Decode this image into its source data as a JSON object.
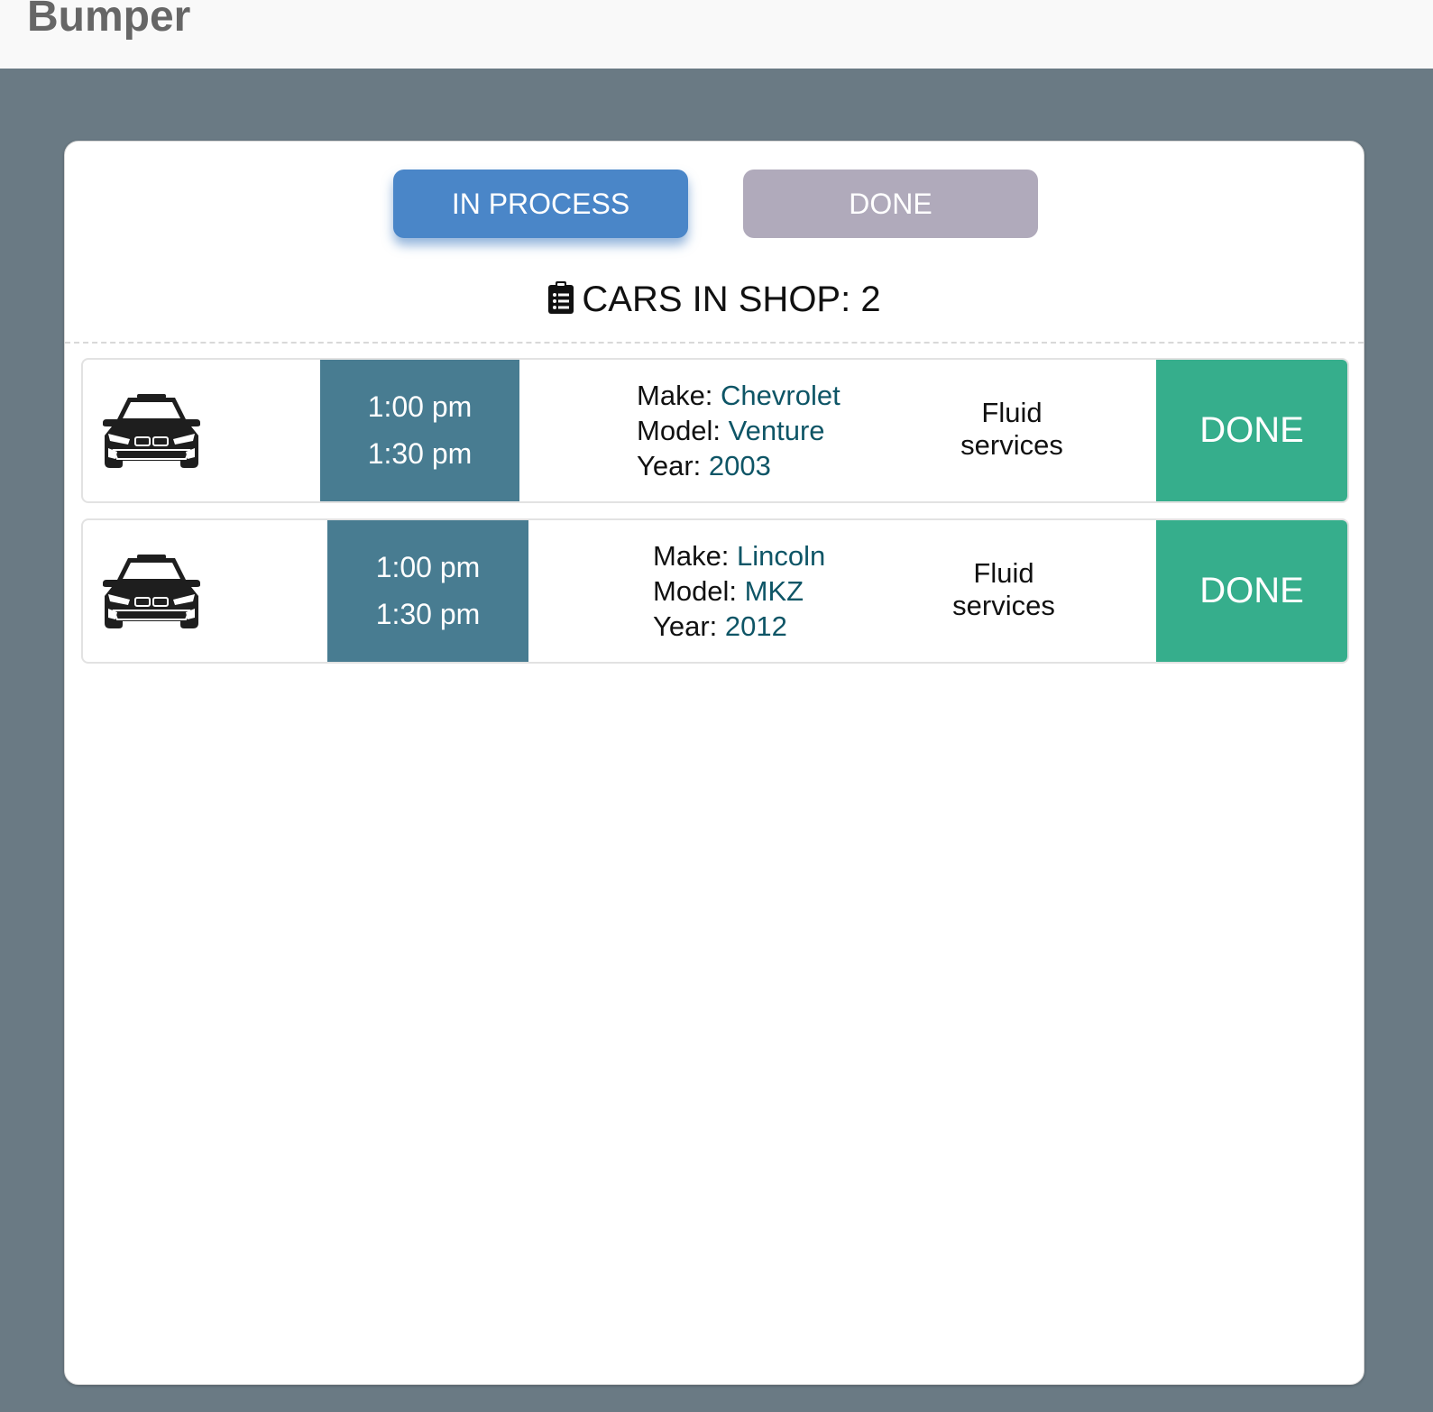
{
  "app": {
    "brand": "Bumper"
  },
  "tabs": [
    {
      "label": "IN PROCESS",
      "active": true
    },
    {
      "label": "DONE",
      "active": false
    }
  ],
  "summary": {
    "label": "CARS IN SHOP: 2",
    "icon": "clipboard-list-icon"
  },
  "colors": {
    "active_tab": "#4a86c8",
    "inactive_tab": "#b0aabb",
    "time_block": "#487c91",
    "done_button": "#36ae8c",
    "value_text": "#0e5566",
    "background": "#6a7a84"
  },
  "cars": [
    {
      "icon": "car-front-icon",
      "time_start": "1:00 pm",
      "time_end": "1:30 pm",
      "make_label": "Make:",
      "make": "Chevrolet",
      "model_label": "Model:",
      "model": "Venture",
      "year_label": "Year:",
      "year": "2003",
      "service_line1": "Fluid",
      "service_line2": "services",
      "action_label": "DONE"
    },
    {
      "icon": "car-front-icon",
      "time_start": "1:00 pm",
      "time_end": "1:30 pm",
      "make_label": "Make:",
      "make": "Lincoln",
      "model_label": "Model:",
      "model": "MKZ",
      "year_label": "Year:",
      "year": "2012",
      "service_line1": "Fluid",
      "service_line2": "services",
      "action_label": "DONE"
    }
  ]
}
